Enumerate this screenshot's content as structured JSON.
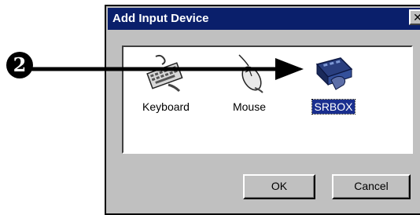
{
  "dialog": {
    "title": "Add Input Device",
    "close_glyph": "✕",
    "items": [
      {
        "label": "Keyboard",
        "icon": "keyboard-icon",
        "selected": false
      },
      {
        "label": "Mouse",
        "icon": "mouse-icon",
        "selected": false
      },
      {
        "label": "SRBOX",
        "icon": "srbox-icon",
        "selected": true
      }
    ],
    "buttons": {
      "ok": "OK",
      "cancel": "Cancel"
    }
  },
  "callout": {
    "number": "2"
  },
  "colors": {
    "title_bar": "#0a1f6b",
    "selection": "#1a2f8f",
    "window_face": "#c0c0c0"
  }
}
